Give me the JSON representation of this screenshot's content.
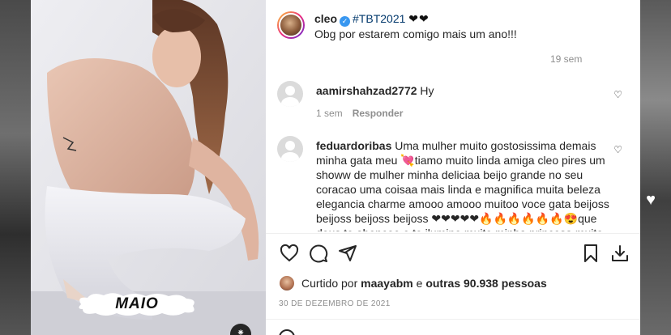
{
  "post": {
    "username": "cleo",
    "hashtag": "#TBT2021",
    "hearts": "❤❤",
    "caption": "Obg por estarem comigo mais um ano!!!",
    "time": "19 sem",
    "image_text": "MAIO"
  },
  "comments": [
    {
      "username": "aamirshahzad2772",
      "text": "Hy",
      "time": "1 sem",
      "reply_label": "Responder"
    },
    {
      "username": "feduardoribas",
      "text": "Uma mulher muito gostosissima demais minha gata meu 💘tiamo muito linda amiga cleo pires um showw de mulher minha deliciaa beijo grande no seu coracao uma coisaa mais linda e magnifica muita beleza elegancia charme amooo amooo muitoo voce gata beijoss beijoss beijoss beijoss ❤❤❤❤❤🔥🔥🔥🔥🔥🔥😍que deus te abencoe e te ilumine muito minha princesa muito"
    }
  ],
  "likes": {
    "prefix": "Curtido por",
    "user": "maayabm",
    "joiner": "e",
    "others": "outras 90.938 pessoas"
  },
  "date": "30 DE DEZEMBRO DE 2021",
  "icons": {
    "like": "heart-outline-icon",
    "comment": "comment-bubble-icon",
    "share": "paper-plane-icon",
    "save": "bookmark-icon",
    "download": "download-tray-icon"
  }
}
